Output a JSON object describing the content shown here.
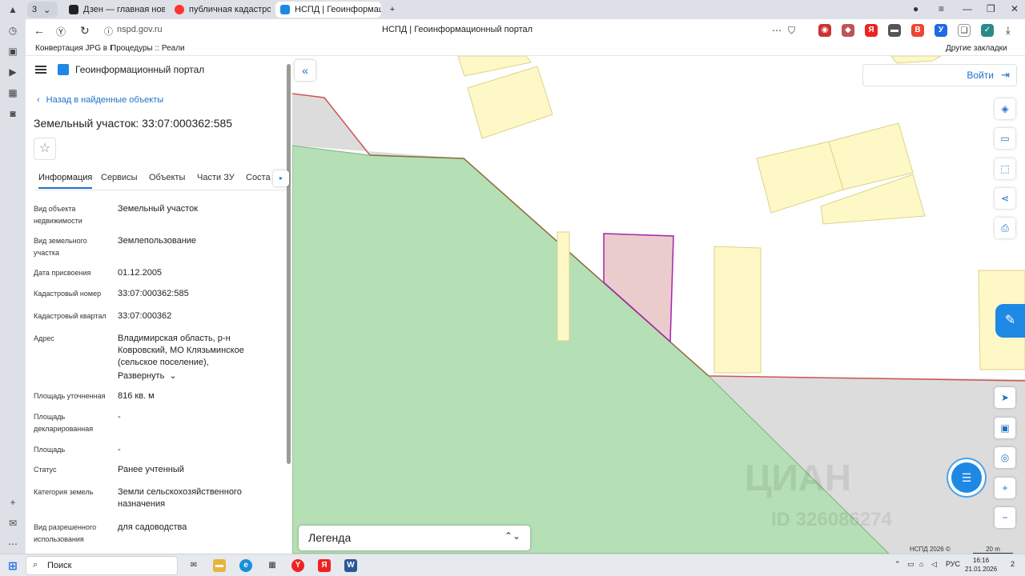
{
  "browser": {
    "tab_count": "3",
    "tabs": [
      {
        "label": "Дзен — главная новостн",
        "active": false
      },
      {
        "label": "публичная кадастровая к",
        "active": false
      },
      {
        "label": "НСПД | Геоинформаці",
        "active": true
      }
    ],
    "close_glyph": "×",
    "new_tab_glyph": "+",
    "url": "nspd.gov.ru",
    "page_title": "НСПД | Геоинформационный портал",
    "bookmarks": [
      "Конвертация JPG в I",
      "Процедуры :: Реали"
    ],
    "other_bookmarks": "Другие закладки"
  },
  "portal": {
    "brand": "Геоинформационный портал",
    "back_link": "Назад в найденные объекты",
    "object_title": "Земельный участок: 33:07:000362:585",
    "star_glyph": "☆",
    "tabs": [
      "Информация",
      "Сервисы",
      "Объекты",
      "Части ЗУ",
      "Соста"
    ],
    "next_glyph": "▸",
    "fields": [
      {
        "label": "Вид объекта недвижимости",
        "value": "Земельный участок"
      },
      {
        "label": "Вид земельного участка",
        "value": "Землепользование"
      },
      {
        "label": "Дата присвоения",
        "value": "01.12.2005"
      },
      {
        "label": "Кадастровый номер",
        "value": "33:07:000362:585"
      },
      {
        "label": "Кадастровый квартал",
        "value": "33:07:000362"
      },
      {
        "label": "Адрес",
        "value": "Владимирская область, р-н Ковровский, МО Клязьминское (сельское поселение),"
      },
      {
        "label": "Площадь уточненная",
        "value": "816 кв. м"
      },
      {
        "label": "Площадь декларированная",
        "value": "-"
      },
      {
        "label": "Площадь",
        "value": "-"
      },
      {
        "label": "Статус",
        "value": "Ранее учтенный"
      },
      {
        "label": "Категория земель",
        "value": "Земли сельскохозяйственного назначения"
      },
      {
        "label": "Вид разрешенного использования",
        "value": "для садоводства"
      }
    ],
    "expand_link": "Развернуть"
  },
  "map": {
    "login_label": "Войти",
    "legend_label": "Легенда",
    "legend_chevron": "⌃⌄",
    "collapse_glyph": "«",
    "footer_note": "НСПД 2026 ©",
    "scale_label": "20 m",
    "watermark": "ЦИАН",
    "watermark_id": "ID 326086274",
    "colors": {
      "parcel_green": "#b5dfb5",
      "parcel_yellow": "#fdf8c6",
      "selected_parcel": "#ebcccc",
      "selected_border": "#a623b0",
      "road_gray": "#dcdcdc",
      "road_border": "#d05454",
      "accent": "#1e88e5"
    }
  },
  "taskbar": {
    "search": "Поиск",
    "lang": "РУС",
    "time": "16:16",
    "date": "21.01.2026",
    "notifications": "2"
  }
}
